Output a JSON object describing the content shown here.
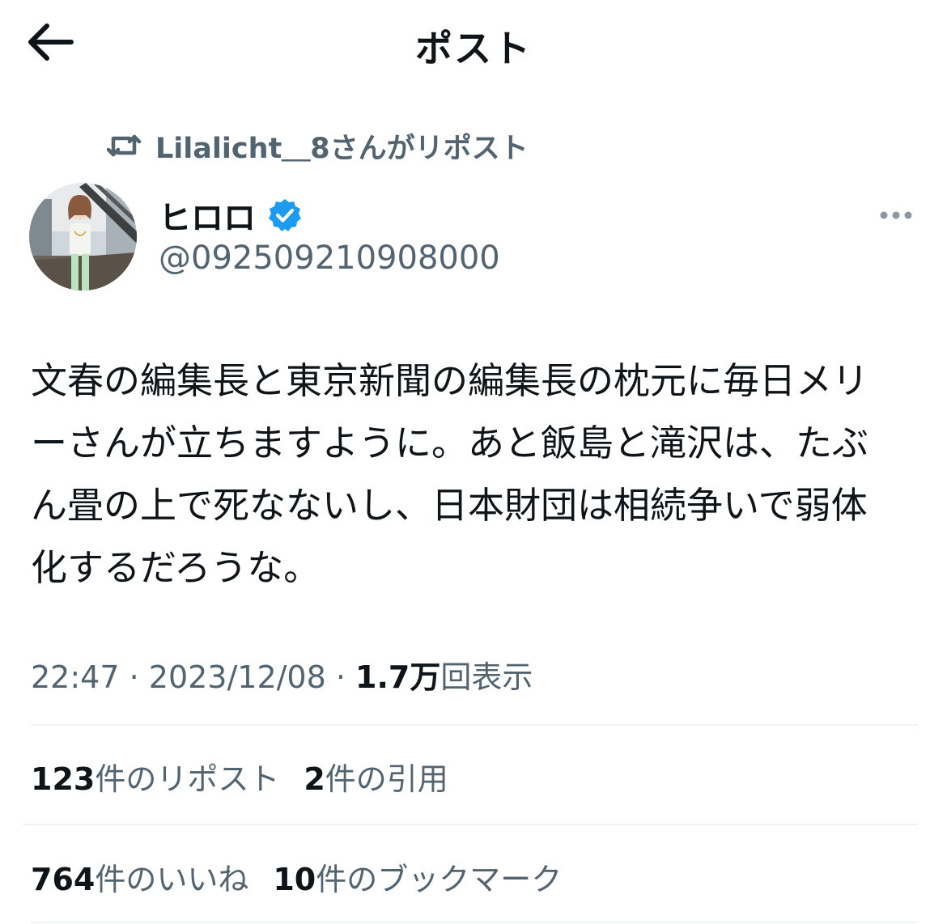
{
  "header": {
    "title": "ポスト",
    "back_icon": "arrow-left-icon"
  },
  "repost": {
    "text": "Lilalicht＿8さんがリポスト",
    "icon": "repost-icon"
  },
  "author": {
    "display_name": "ヒロロ",
    "handle": "@092509210908000",
    "verified": true,
    "verified_color": "#1d9bf0"
  },
  "tweet": {
    "lines": [
      "文春の編集長と東京新聞の編集長の枕元に毎日メリ",
      "ーさんが立ちますように。あと飯島と滝沢は、たぶ",
      "ん畳の上で死なないし、日本財団は相続争いで弱体",
      "化するだろうな。"
    ]
  },
  "meta": {
    "time": "22:47",
    "sep1": " · ",
    "date": "2023/12/08",
    "sep2": " · ",
    "views_count": "1.7万",
    "views_label": "回表示"
  },
  "stats": {
    "reposts_count": "123",
    "reposts_label": "件のリポスト",
    "quotes_count": "2",
    "quotes_label": "件の引用",
    "likes_count": "764",
    "likes_label": "件のいいね",
    "bookmarks_count": "10",
    "bookmarks_label": "件のブックマーク"
  },
  "colors": {
    "text_primary": "#0f1419",
    "text_secondary": "#536471",
    "divider": "#eff3f4"
  }
}
